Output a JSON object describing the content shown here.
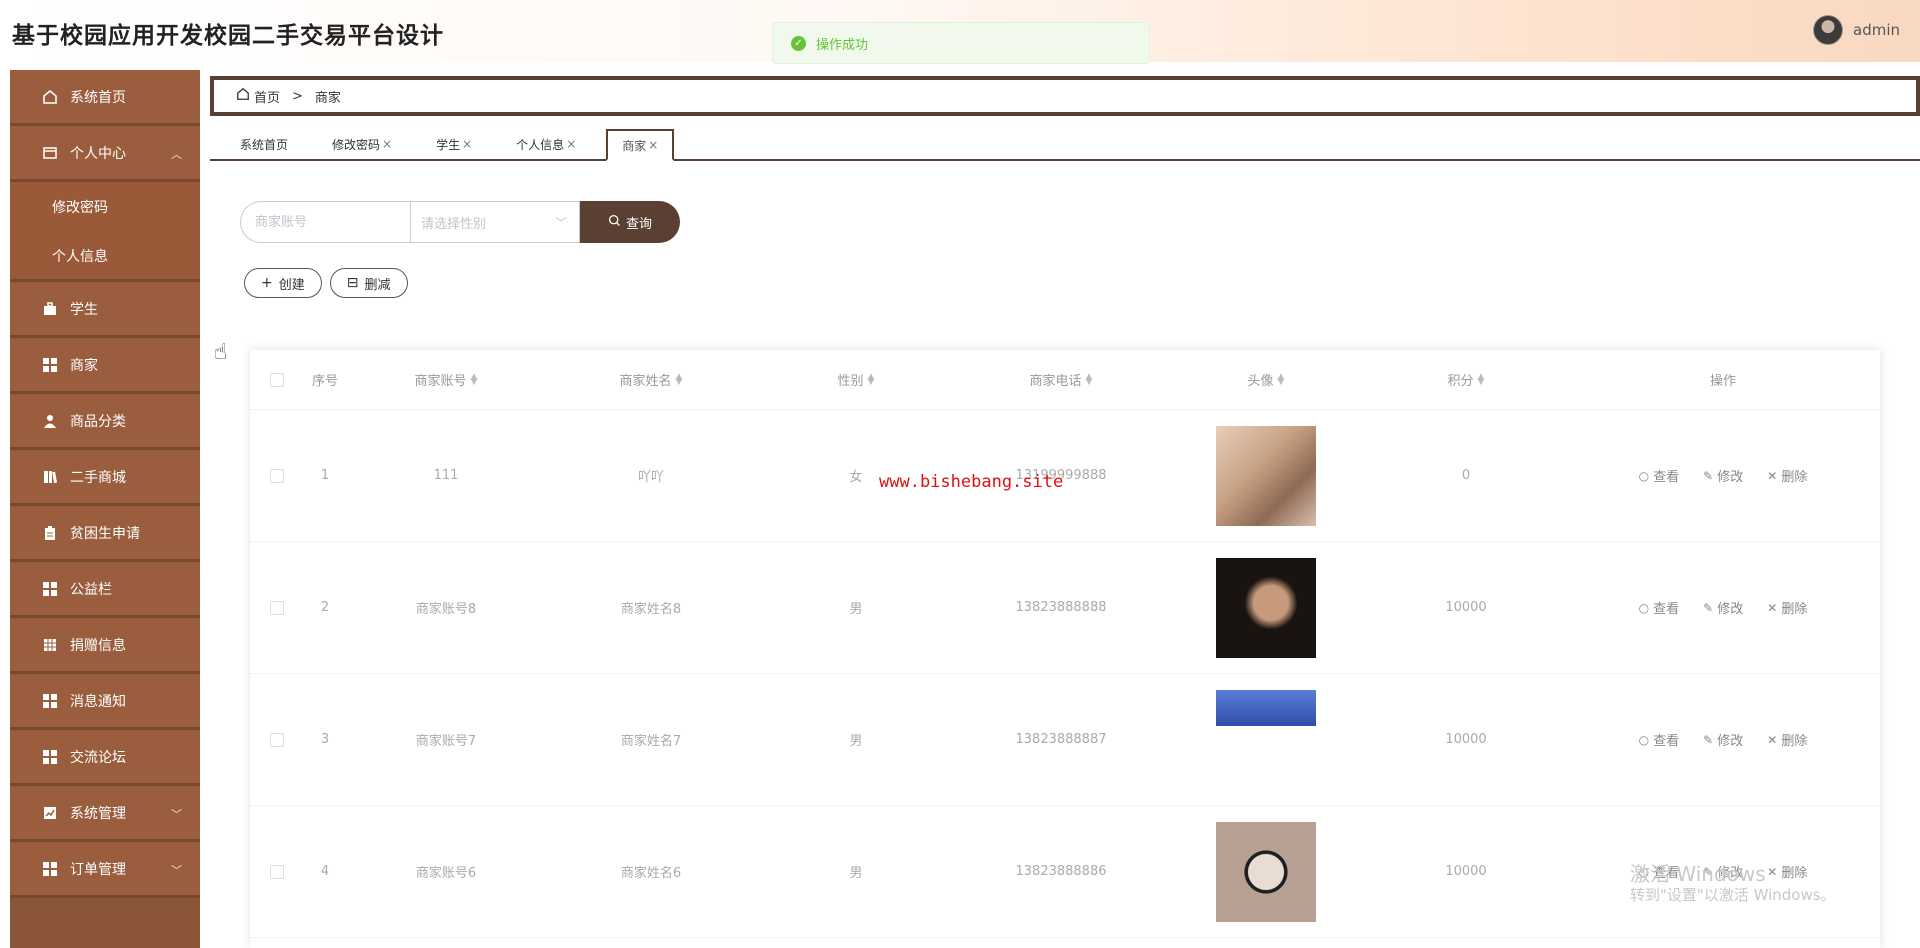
{
  "header": {
    "title": "基于校园应用开发校园二手交易平台设计",
    "username": "admin"
  },
  "toast": {
    "message": "操作成功"
  },
  "sidebar": {
    "items": [
      {
        "label": "系统首页",
        "icon": "home-icon"
      },
      {
        "label": "个人中心",
        "icon": "user-center-icon"
      },
      {
        "label": "修改密码"
      },
      {
        "label": "个人信息"
      },
      {
        "label": "学生",
        "icon": "briefcase-icon"
      },
      {
        "label": "商家",
        "icon": "grid-icon"
      },
      {
        "label": "商品分类",
        "icon": "person-icon"
      },
      {
        "label": "二手商城",
        "icon": "book-icon"
      },
      {
        "label": "贫困生申请",
        "icon": "clipboard-icon"
      },
      {
        "label": "公益栏",
        "icon": "grid-icon"
      },
      {
        "label": "捐赠信息",
        "icon": "table-icon"
      },
      {
        "label": "消息通知",
        "icon": "grid-icon"
      },
      {
        "label": "交流论坛",
        "icon": "grid-icon"
      },
      {
        "label": "系统管理",
        "icon": "chart-icon"
      },
      {
        "label": "订单管理",
        "icon": "grid-icon"
      }
    ]
  },
  "breadcrumb": {
    "home": "首页",
    "sep": ">",
    "current": "商家"
  },
  "tabs": [
    {
      "label": "系统首页",
      "closable": false
    },
    {
      "label": "修改密码",
      "closable": true
    },
    {
      "label": "学生",
      "closable": true
    },
    {
      "label": "个人信息",
      "closable": true
    },
    {
      "label": "商家",
      "closable": true
    }
  ],
  "tab_close": "×",
  "search": {
    "account_placeholder": "商家账号",
    "gender_placeholder": "请选择性别",
    "button": "查询"
  },
  "actions": {
    "create": "创建",
    "delete": "删减"
  },
  "table": {
    "headers": [
      "序号",
      "商家账号",
      "商家姓名",
      "性别",
      "商家电话",
      "头像",
      "积分",
      "操作"
    ],
    "rows": [
      {
        "idx": "1",
        "account": "111",
        "name": "吖吖",
        "gender": "女",
        "phone": "13199999888",
        "score": "0"
      },
      {
        "idx": "2",
        "account": "商家账号8",
        "name": "商家姓名8",
        "gender": "男",
        "phone": "13823888888",
        "score": "10000"
      },
      {
        "idx": "3",
        "account": "商家账号7",
        "name": "商家姓名7",
        "gender": "男",
        "phone": "13823888887",
        "score": "10000"
      },
      {
        "idx": "4",
        "account": "商家账号6",
        "name": "商家姓名6",
        "gender": "男",
        "phone": "13823888886",
        "score": "10000"
      }
    ],
    "ops": {
      "view": "查看",
      "edit": "修改",
      "delete": "删除"
    }
  },
  "watermark": "www.bishebang.site",
  "windows_activation": {
    "line1": "激活 Windows",
    "line2": "转到\"设置\"以激活 Windows。"
  }
}
